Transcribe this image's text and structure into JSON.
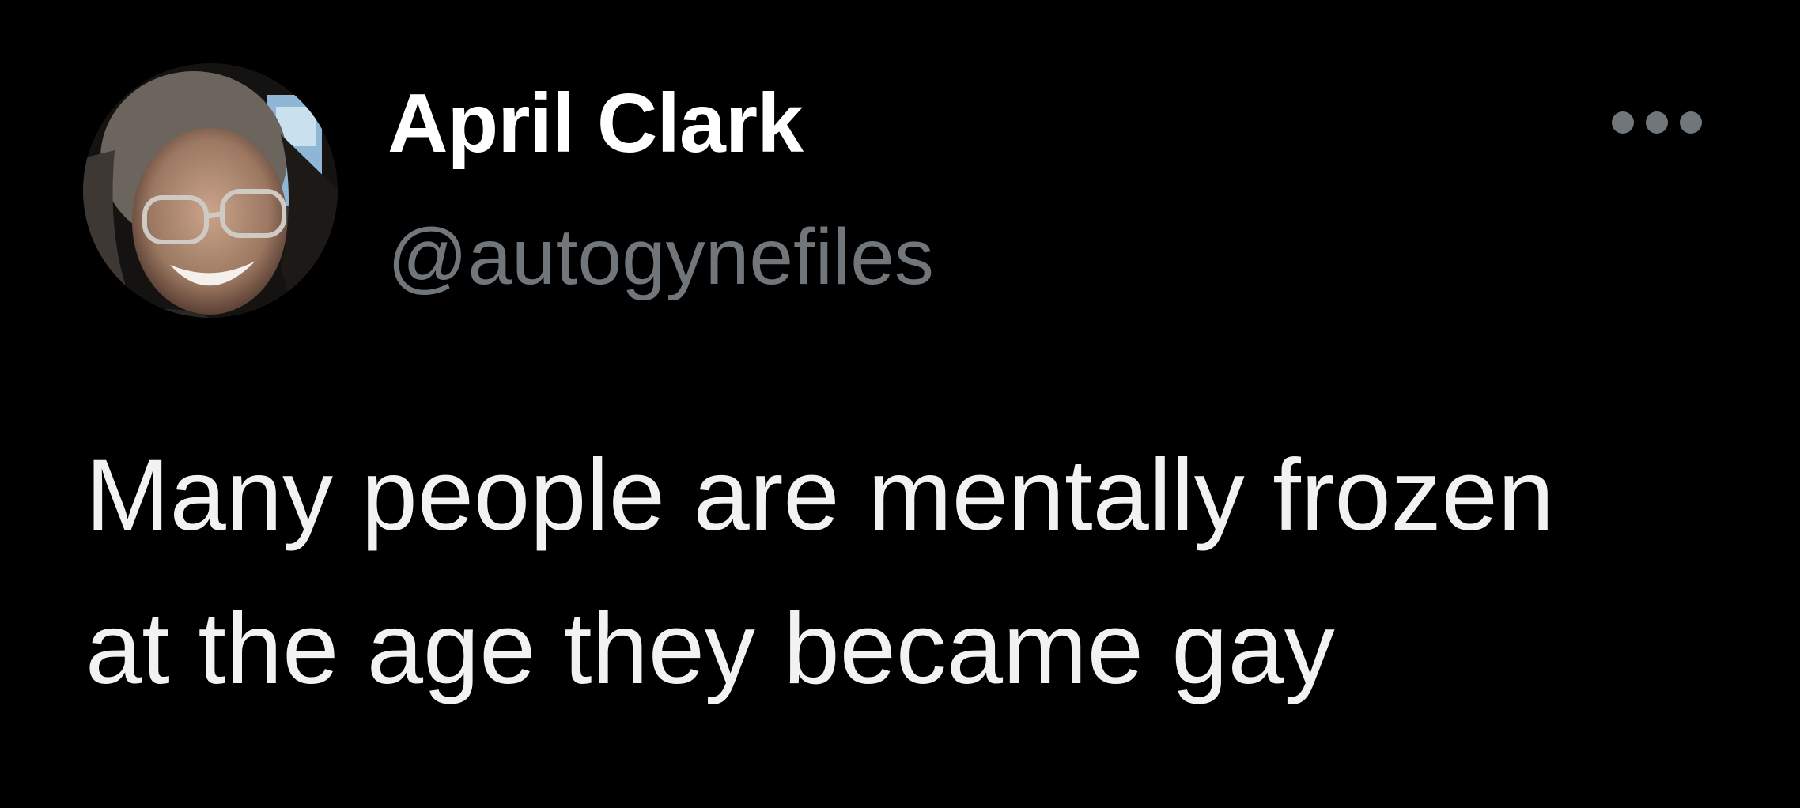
{
  "author": {
    "display_name": "April Clark",
    "handle": "@autogynefiles",
    "avatar_icon": "profile-photo"
  },
  "actions": {
    "more_icon": "more-horizontal-icon"
  },
  "tweet": {
    "lines": [
      "Many people are mentally frozen",
      "at the age they became gay"
    ]
  },
  "colors": {
    "background": "#000000",
    "display_name": "#ffffff",
    "handle": "#71767b",
    "text": "#f2f2f2",
    "more_icon": "#71767b"
  }
}
